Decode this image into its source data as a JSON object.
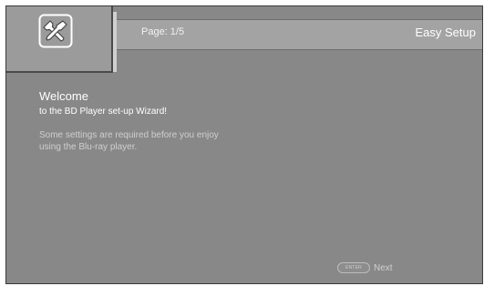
{
  "header": {
    "page_indicator": "Page: 1/5",
    "title": "Easy Setup",
    "icon": "wrench-screwdriver-icon"
  },
  "content": {
    "welcome_title": "Welcome",
    "welcome_subtitle": "to the BD Player set-up Wizard!",
    "description_lines": [
      "Some settings are required before you enjoy",
      "using the Blu-ray player."
    ]
  },
  "footer": {
    "enter_key_label": "ENTER",
    "next_label": "Next"
  },
  "colors": {
    "screen_bg": "#888888",
    "header_bar": "#a3a3a3",
    "icon_panel": "#9b9b9b",
    "text_primary": "#ffffff",
    "text_secondary": "#cfcfcf"
  }
}
